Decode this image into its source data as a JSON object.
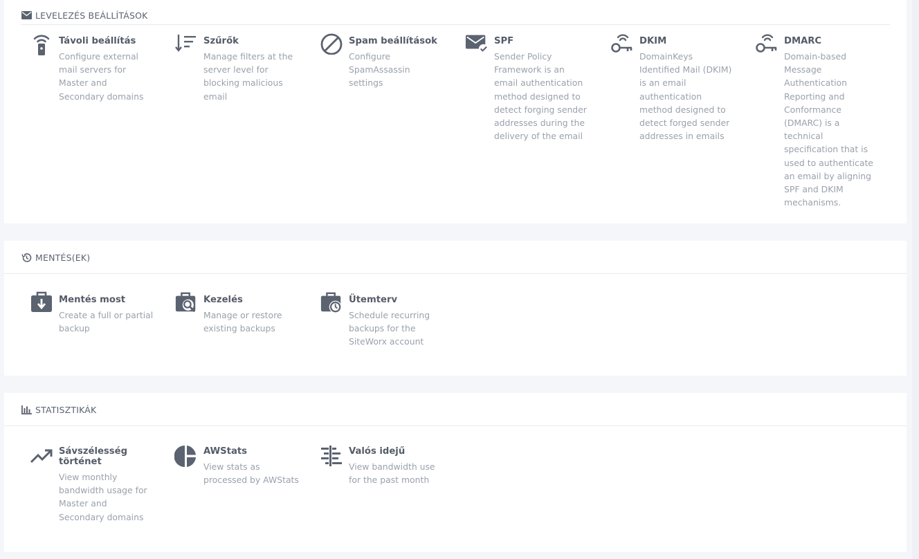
{
  "mail": {
    "heading": "LEVELEZÉS BEÁLLÍTÁSOK",
    "items": [
      {
        "title": "Távoli beállítás",
        "desc": "Configure external mail servers for Master and Secondary domains"
      },
      {
        "title": "Szűrők",
        "desc": "Manage filters at the server level for blocking malicious email"
      },
      {
        "title": "Spam beállítások",
        "desc": "Configure SpamAssassin settings"
      },
      {
        "title": "SPF",
        "desc": "Sender Policy Framework is an email authentication method designed to detect forging sender addresses during the delivery of the email"
      },
      {
        "title": "DKIM",
        "desc": "DomainKeys Identified Mail (DKIM) is an email authentication method designed to detect forged sender addresses in emails"
      },
      {
        "title": "DMARC",
        "desc": "Domain-based Message Authentication Reporting and Conformance (DMARC) is a technical specification that is used to authenticate an email by aligning SPF and DKIM mechanisms."
      }
    ]
  },
  "backup": {
    "heading": "MENTÉS(EK)",
    "items": [
      {
        "title": "Mentés most",
        "desc": "Create a full or partial backup"
      },
      {
        "title": "Kezelés",
        "desc": "Manage or restore existing backups"
      },
      {
        "title": "Ütemterv",
        "desc": "Schedule recurring backups for the SiteWorx account"
      }
    ]
  },
  "stats": {
    "heading": "STATISZTIKÁK",
    "items": [
      {
        "title": "Sávszélesség történet",
        "desc": "View monthly bandwidth usage for Master and Secondary domains"
      },
      {
        "title": "AWStats",
        "desc": "View stats as processed by AWStats"
      },
      {
        "title": "Valós idejű",
        "desc": "View bandwidth use for the past month"
      }
    ]
  },
  "colors": {
    "icon": "#5b6270",
    "title": "#555c68",
    "desc": "#9aa1ac",
    "background": "#f5f6fa"
  }
}
